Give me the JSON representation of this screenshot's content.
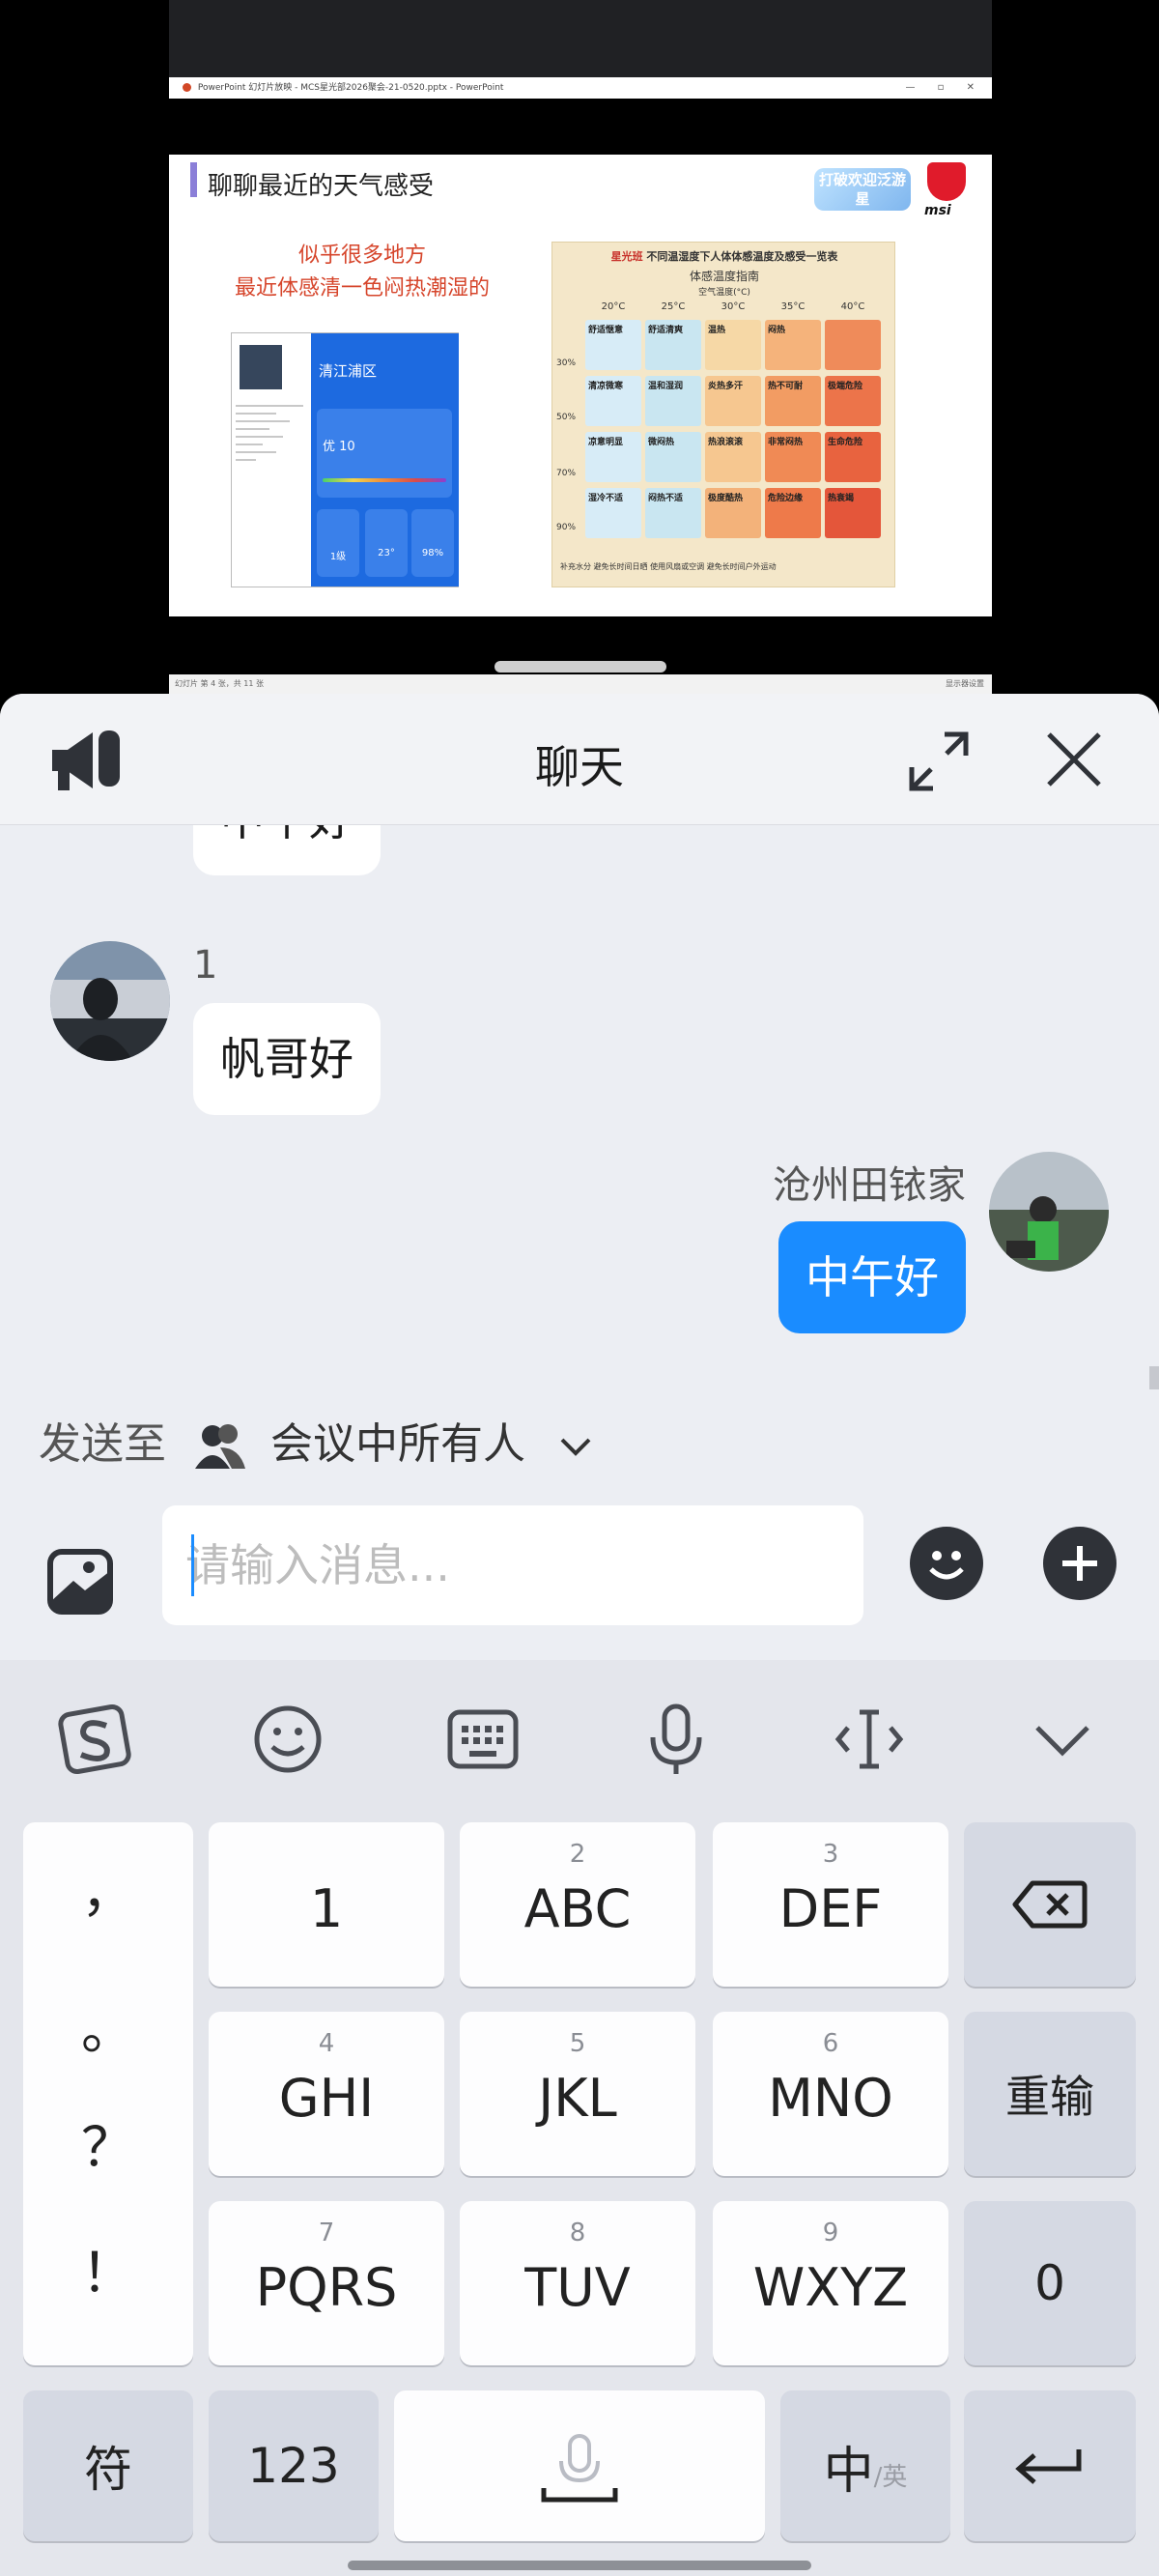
{
  "presentation": {
    "window_title": "PowerPoint 幻灯片放映 - MCS星光部2026聚会-21-0520.pptx - PowerPoint",
    "slide_title": "聊聊最近的天气感受",
    "slide_red_text_1": "似乎很多地方",
    "slide_red_text_2": "最近体感清一色闷热潮湿的",
    "badge_text": "打破欢迎泛游星",
    "brand_text": "msi",
    "screenshot_area": "清江浦区",
    "screenshot_aqi": "优 10",
    "screenshot_values": [
      "1级",
      "23°",
      "98%"
    ],
    "table_brand": "星光班",
    "table_title": "不同温湿度下人体体感温度及感受一览表",
    "table_subtitle": "体感温度指南",
    "table_axis_label": "空气温度(°C)",
    "table_columns": [
      "20°C",
      "25°C",
      "30°C",
      "35°C",
      "40°C"
    ],
    "table_rows": [
      "30%",
      "50%",
      "70%",
      "90%"
    ],
    "table_cells": [
      [
        "舒适惬意",
        "舒适清爽",
        "温热",
        "闷热",
        ""
      ],
      [
        "清凉微寒",
        "温和湿润",
        "炎热多汗",
        "热不可耐",
        "极端危险"
      ],
      [
        "凉意明显",
        "微闷热",
        "热浪滚滚",
        "非常闷热",
        "生命危险"
      ],
      [
        "湿冷不适",
        "闷热不适",
        "极度酷热",
        "危险边缘",
        "热衰竭"
      ]
    ],
    "table_footer": "补充水分   避免长时间日晒   使用风扇或空调   避免长时间户外运动",
    "status_left": "幻灯片 第 4 张，共 11 张",
    "status_right": "显示器设置"
  },
  "chat": {
    "title": "聊天",
    "messages": [
      {
        "direction": "in",
        "text": "中午好"
      },
      {
        "direction": "in",
        "sender": "1",
        "text": "帆哥好"
      },
      {
        "direction": "out",
        "sender": "沧州田铱家",
        "text": "中午好"
      }
    ],
    "send_to_prefix": "发送至",
    "send_to_target": "会议中所有人",
    "input_placeholder": "请输入消息..."
  },
  "keyboard": {
    "punctuation": [
      "，",
      "。",
      "？",
      "！"
    ],
    "keys": [
      {
        "num": "",
        "label": "1"
      },
      {
        "num": "2",
        "label": "ABC"
      },
      {
        "num": "3",
        "label": "DEF"
      },
      {
        "num": "4",
        "label": "GHI"
      },
      {
        "num": "5",
        "label": "JKL"
      },
      {
        "num": "6",
        "label": "MNO"
      },
      {
        "num": "7",
        "label": "PQRS"
      },
      {
        "num": "8",
        "label": "TUV"
      },
      {
        "num": "9",
        "label": "WXYZ"
      }
    ],
    "reset_label": "重输",
    "zero_label": "0",
    "symbols_label": "符",
    "numbers_label": "123",
    "lang_main": "中",
    "lang_alt": "/英"
  },
  "colors": {
    "accent_blue": "#1a8cff",
    "slide_red": "#d6452b"
  }
}
